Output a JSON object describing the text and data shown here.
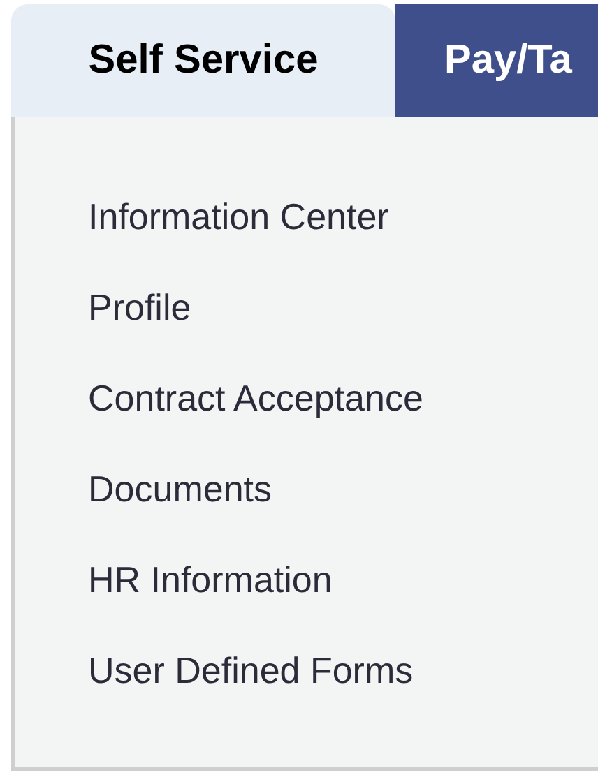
{
  "tabs": [
    {
      "label": "Self Service",
      "selected": true
    },
    {
      "label": "Pay/Ta",
      "selected": false
    }
  ],
  "menu": {
    "items": [
      {
        "label": "Information Center"
      },
      {
        "label": "Profile"
      },
      {
        "label": "Contract Acceptance"
      },
      {
        "label": "Documents"
      },
      {
        "label": "HR Information"
      },
      {
        "label": "User Defined Forms"
      }
    ]
  }
}
